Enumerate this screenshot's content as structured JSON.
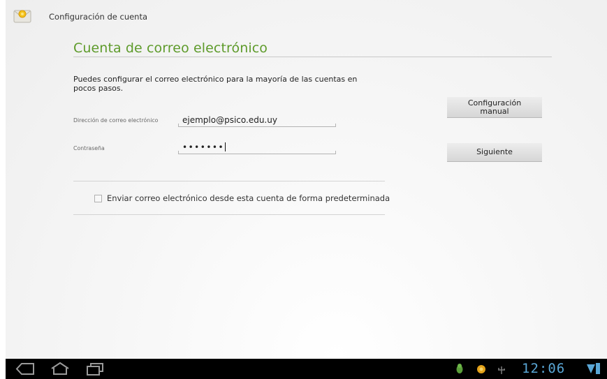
{
  "action_bar": {
    "icon": "email-envelope-icon",
    "title": "Configuración de cuenta"
  },
  "main": {
    "heading": "Cuenta de correo electrónico",
    "instructions": "Puedes configurar el correo electrónico para la mayoría de las cuentas en pocos pasos.",
    "email": {
      "label": "Dirección de correo electrónico",
      "value": "ejemplo@psico.edu.uy"
    },
    "password": {
      "label": "Contraseña",
      "masked_value": "•••••••"
    },
    "buttons": {
      "manual_setup": "Configuración manual",
      "next": "Siguiente"
    },
    "default_account_checkbox": {
      "label": "Enviar correo electrónico desde esta cuenta de forma predeterminada",
      "checked": false
    }
  },
  "system_bar": {
    "nav_icons": [
      "back-icon",
      "home-icon",
      "recent-apps-icon"
    ],
    "status_icons": [
      "android-debug-icon",
      "notification-icon",
      "usb-icon",
      "wifi-icon",
      "battery-icon"
    ],
    "clock": "12:06"
  },
  "colors": {
    "heading_green": "#5e9b2b",
    "clock_blue": "#5aa7d6",
    "system_bar": "#000000"
  }
}
